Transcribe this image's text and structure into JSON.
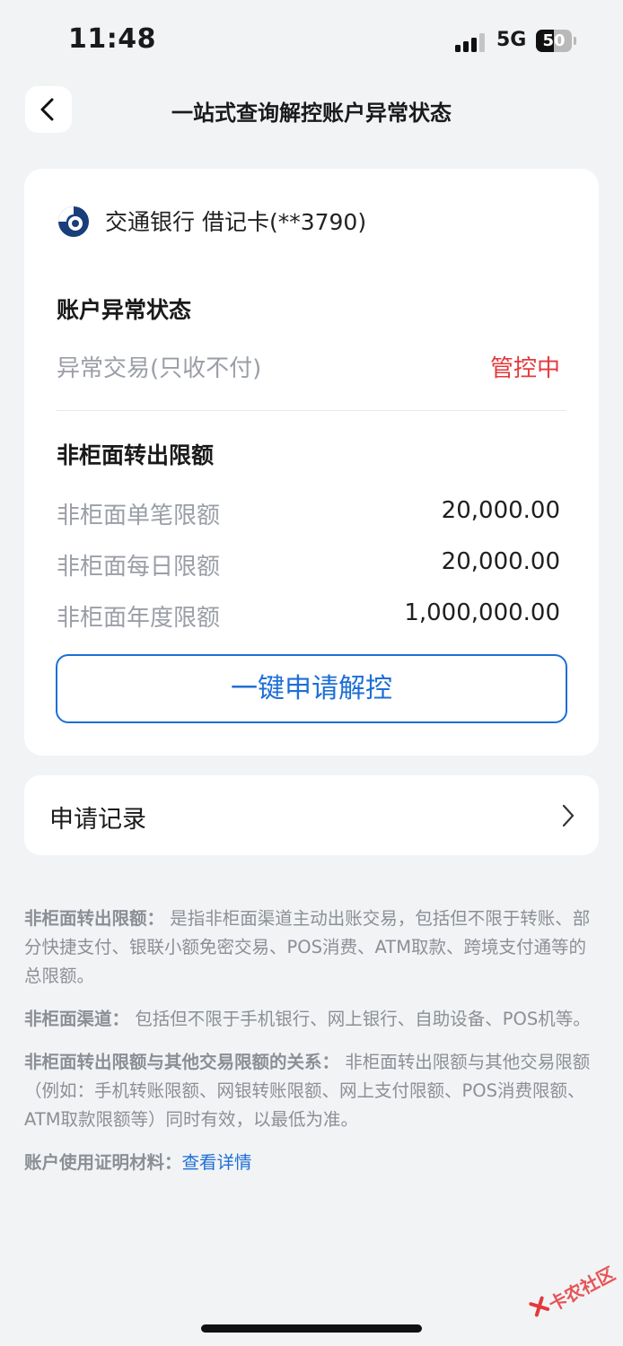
{
  "status_bar": {
    "time": "11:48",
    "network": "5G",
    "battery": "50",
    "battery_level_percent": 50
  },
  "nav": {
    "title": "一站式查询解控账户异常状态"
  },
  "card": {
    "bank_name": "交通银行 借记卡(**3790)",
    "status_section_title": "账户异常状态",
    "status_label": "异常交易(只收不付)",
    "status_value": "管控中",
    "limit_section_title": "非柜面转出限额",
    "limits": [
      {
        "label": "非柜面单笔限额",
        "value": "20,000.00"
      },
      {
        "label": "非柜面每日限额",
        "value": "20,000.00"
      },
      {
        "label": "非柜面年度限额",
        "value": "1,000,000.00"
      }
    ],
    "apply_button": "一键申请解控"
  },
  "record": {
    "label": "申请记录"
  },
  "notes": [
    {
      "title": "非柜面转出限额：",
      "text": "是指非柜面渠道主动出账交易，包括但不限于转账、部分快捷支付、银联小额免密交易、POS消费、ATM取款、跨境支付通等的总限额。"
    },
    {
      "title": "非柜面渠道：",
      "text": "包括但不限于手机银行、网上银行、自助设备、POS机等。"
    },
    {
      "title": "非柜面转出限额与其他交易限额的关系：",
      "text": "非柜面转出限额与其他交易限额（例如：手机转账限额、网银转账限额、网上支付限额、POS消费限额、ATM取款限额等）同时有效，以最低为准。"
    }
  ],
  "proof": {
    "label": "账户使用证明材料：",
    "link": "查看详情"
  },
  "watermark": {
    "text": "卡农社区"
  },
  "colors": {
    "accent": "#1d6fd6",
    "alert": "#e4393c",
    "background": "#f2f3f5"
  },
  "icons": {
    "back": "chevron-left-icon",
    "record": "chevron-right-icon",
    "bank": "bocom-logo-icon"
  }
}
